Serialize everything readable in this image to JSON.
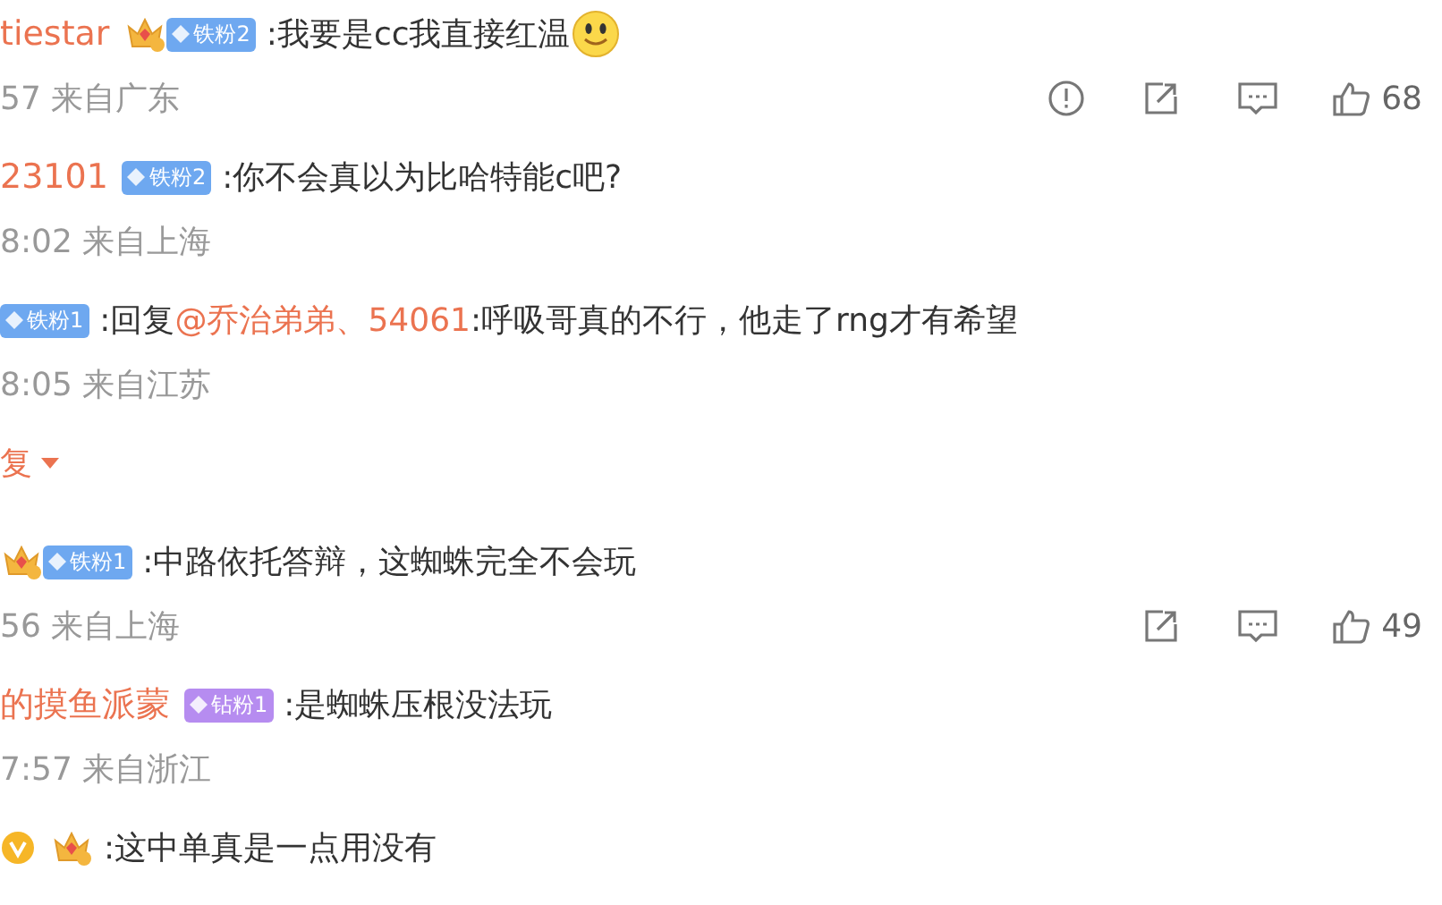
{
  "comments": [
    {
      "name": "tiestar",
      "badges": [
        {
          "kind": "crown"
        },
        {
          "kind": "fan",
          "label": "铁粉2",
          "color": "#6ea8f0"
        }
      ],
      "parts": [
        {
          "kind": "text",
          "text": ":我要是cc我直接红温"
        },
        {
          "kind": "emoji"
        }
      ],
      "meta": "57 来自广东",
      "actions": [
        {
          "kind": "report"
        },
        {
          "kind": "share"
        },
        {
          "kind": "comment"
        },
        {
          "kind": "like",
          "count": "68"
        }
      ]
    },
    {
      "name": "23101",
      "badges": [
        {
          "kind": "fan",
          "label": "铁粉2",
          "color": "#6ea8f0"
        }
      ],
      "parts": [
        {
          "kind": "text",
          "text": ":你不会真以为比哈特能c吧?"
        }
      ],
      "meta": "8:02 来自上海"
    },
    {
      "badges": [
        {
          "kind": "fan",
          "label": "铁粉1",
          "color": "#6ea8f0"
        }
      ],
      "parts": [
        {
          "kind": "text",
          "text": ":回复"
        },
        {
          "kind": "mention",
          "text": "@乔治弟弟、54061"
        },
        {
          "kind": "text",
          "text": ":呼吸哥真的不行，他走了rng才有希望"
        }
      ],
      "meta": "8:05 来自江苏"
    },
    {
      "kind": "more",
      "label": "复"
    },
    {
      "badges": [
        {
          "kind": "crown"
        },
        {
          "kind": "fan",
          "label": "铁粉1",
          "color": "#6ea8f0"
        }
      ],
      "parts": [
        {
          "kind": "text",
          "text": ":中路依托答辩，这蜘蛛完全不会玩"
        }
      ],
      "meta": "56 来自上海",
      "actions": [
        {
          "kind": "share"
        },
        {
          "kind": "comment"
        },
        {
          "kind": "like",
          "count": "49"
        }
      ]
    },
    {
      "name": "的摸鱼派蒙",
      "badges": [
        {
          "kind": "fan",
          "label": "钻粉1",
          "color": "#b68cf0"
        }
      ],
      "parts": [
        {
          "kind": "text",
          "text": ":是蜘蛛压根没法玩"
        }
      ],
      "meta": "7:57 来自浙江"
    },
    {
      "badges": [
        {
          "kind": "verified"
        },
        {
          "kind": "crown"
        }
      ],
      "parts": [
        {
          "kind": "text",
          "text": ":这中单真是一点用没有"
        }
      ]
    }
  ]
}
